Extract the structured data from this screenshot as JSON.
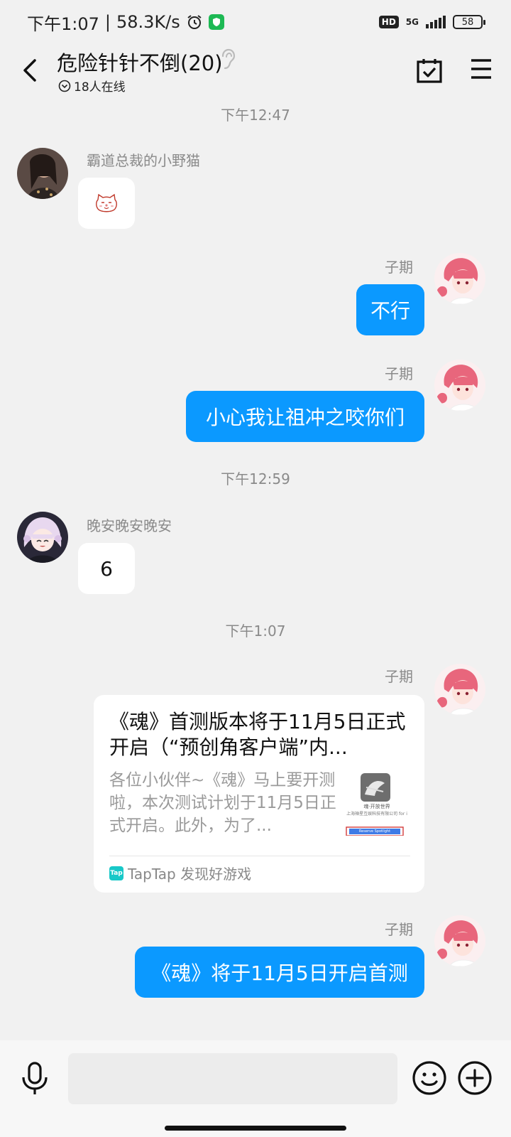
{
  "status_bar": {
    "time": "下午1:07",
    "network_speed": "58.3K/s",
    "hd_badge": "HD",
    "signal_label": "5G",
    "battery": "58"
  },
  "header": {
    "title": "危险针针不倒(20)",
    "online_count": "18人在线"
  },
  "messages": {
    "ts1": "下午12:47",
    "m1": {
      "sender": "霸道总裁的小野猫",
      "sticker": "cat-face-sticker"
    },
    "m2": {
      "sender": "子期",
      "text": "不行"
    },
    "m3": {
      "sender": "子期",
      "text": "小心我让祖冲之咬你们"
    },
    "ts2": "下午12:59",
    "m4": {
      "sender": "晚安晚安晚安",
      "text": "6"
    },
    "ts3": "下午1:07",
    "m5": {
      "sender": "子期",
      "card": {
        "title": "《魂》首测版本将于11月5日正式开启（“预创角客户端”内...",
        "description": "各位小伙伴~《魂》马上要开测啦，本次测试计划于11月5日正式开启。此外，为了...",
        "thumb_caption": "魂·开放世界",
        "thumb_company": "上海禅星互娱科技有限公司 for i",
        "thumb_button": "Reserve Spotlight",
        "source_logo": "Tap",
        "source": "TapTap 发现好游戏"
      }
    },
    "m6": {
      "sender": "子期",
      "text": "《魂》将于11月5日开启首测"
    }
  },
  "input": {
    "placeholder": ""
  },
  "colors": {
    "outgoing_bubble": "#0b99ff",
    "incoming_bubble": "#ffffff",
    "background": "#f1f1f1",
    "timestamp": "#8a8a8a"
  },
  "icons": [
    "back-arrow-icon",
    "ear-icon",
    "calendar-check-icon",
    "menu-icon",
    "mic-icon",
    "emoji-icon",
    "plus-icon",
    "alarm-icon",
    "shield-icon"
  ]
}
